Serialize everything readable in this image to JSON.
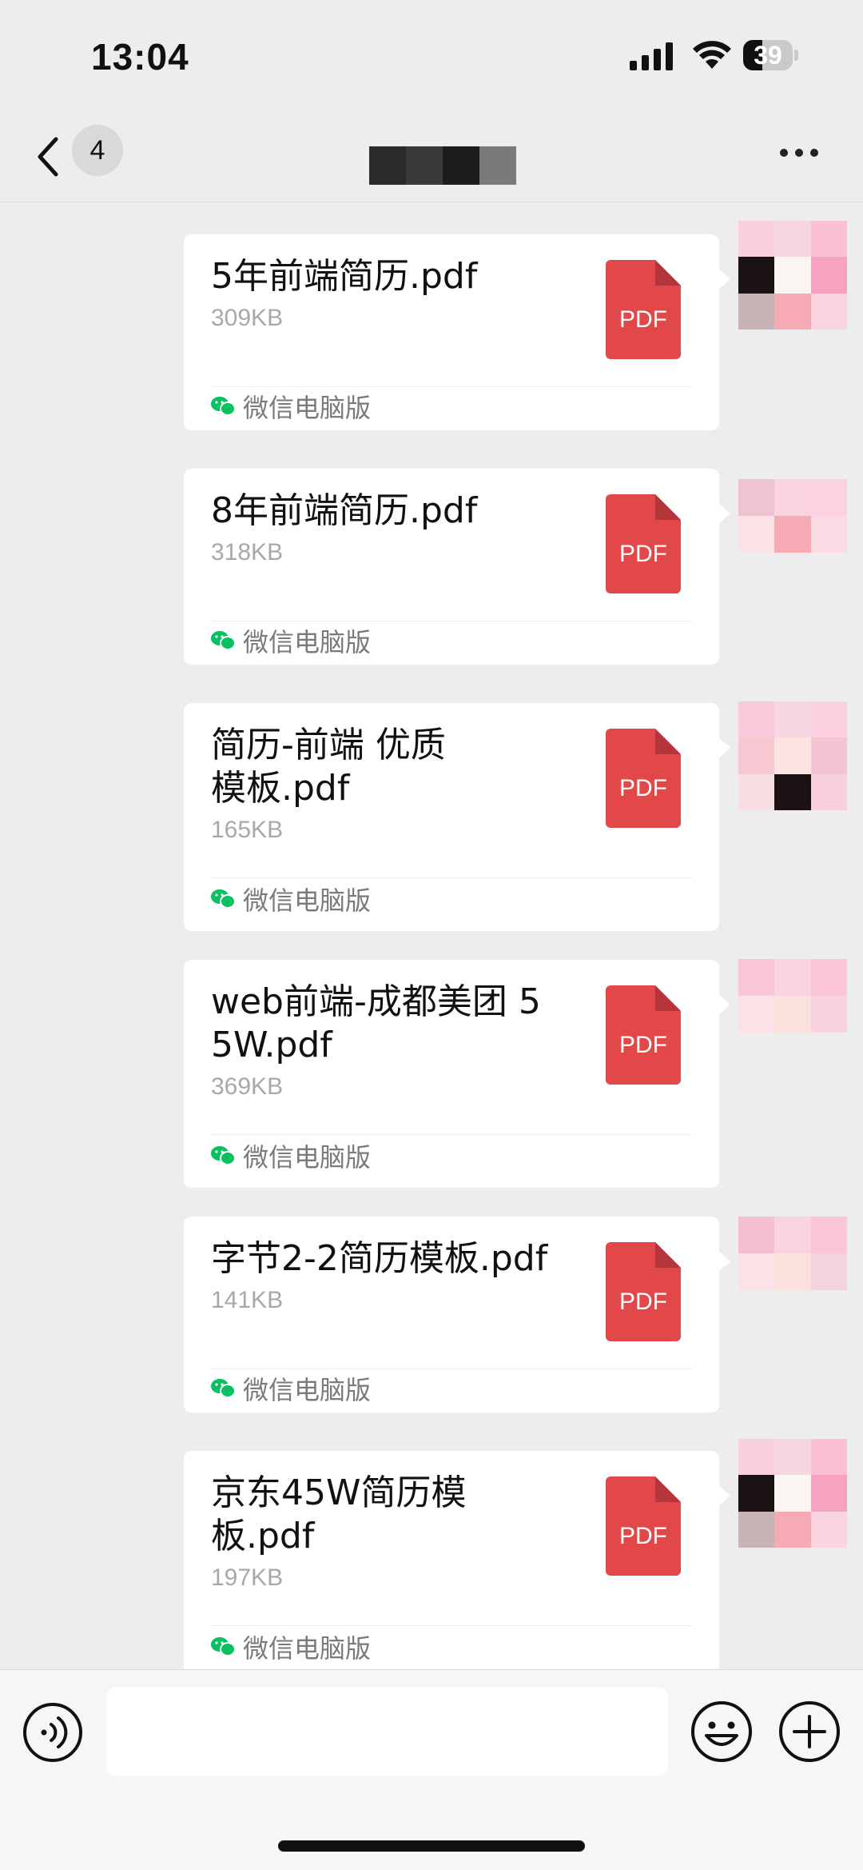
{
  "status_bar": {
    "time": "13:04",
    "battery": "39",
    "battery_level": 0.39
  },
  "nav": {
    "unread_count": "4",
    "more_icon": "ellipsis-icon",
    "back_icon": "chevron-left-icon"
  },
  "messages": [
    {
      "name": "5年前端简历.pdf",
      "size": "309KB",
      "source": "微信电脑版",
      "icon_label": "PDF"
    },
    {
      "name": "8年前端简历.pdf",
      "size": "318KB",
      "source": "微信电脑版",
      "icon_label": "PDF"
    },
    {
      "name": "简历-前端 优质模板.pdf",
      "size": "165KB",
      "source": "微信电脑版",
      "icon_label": "PDF"
    },
    {
      "name": "web前端-成都美团 55W.pdf",
      "size": "369KB",
      "source": "微信电脑版",
      "icon_label": "PDF"
    },
    {
      "name": "字节2-2简历模板.pdf",
      "size": "141KB",
      "source": "微信电脑版",
      "icon_label": "PDF"
    },
    {
      "name": "京东45W简历模板.pdf",
      "size": "197KB",
      "source": "微信电脑版",
      "icon_label": "PDF"
    }
  ],
  "colors": {
    "pdf_red": "#e2474a",
    "wechat_green": "#07c160",
    "bubble": "#ffffff",
    "background": "#ededed"
  }
}
